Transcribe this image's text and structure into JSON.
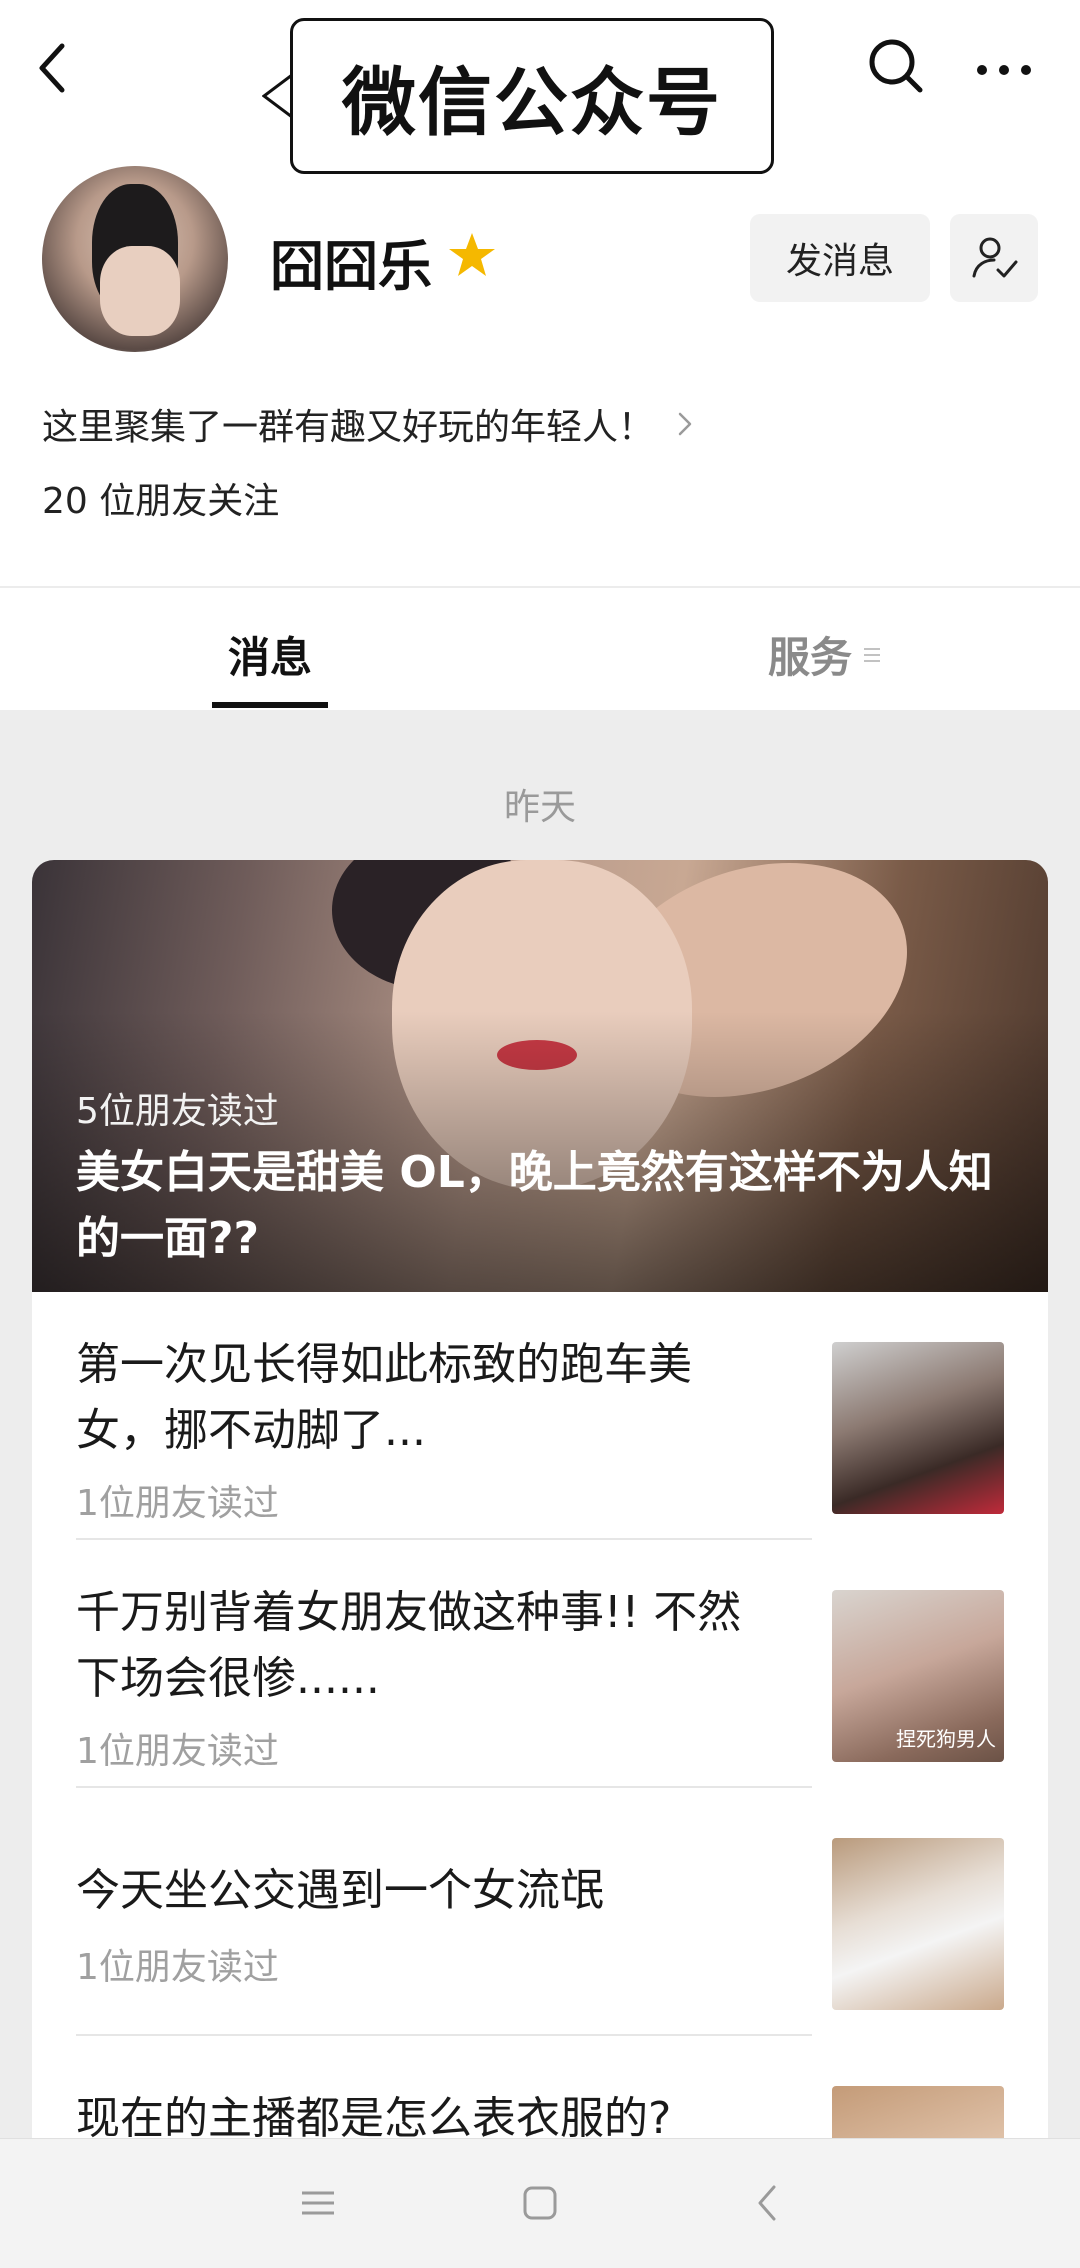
{
  "header": {
    "callout_label": "微信公众号"
  },
  "profile": {
    "name": "囧囧乐",
    "message_button": "发消息",
    "intro": "这里聚集了一群有趣又好玩的年轻人！",
    "followers": "20 位朋友关注"
  },
  "tabs": [
    {
      "label": "消息",
      "active": true
    },
    {
      "label": "服务",
      "active": false
    }
  ],
  "feed": {
    "date": "昨天",
    "cover": {
      "readers": "5位朋友读过",
      "title": "美女白天是甜美 OL，晚上竟然有这样不为人知的一面??"
    },
    "articles": [
      {
        "title": "第一次见长得如此标致的跑车美女，挪不动脚了...",
        "reads": "1位朋友读过",
        "thumb_watermark": ""
      },
      {
        "title": "千万别背着女朋友做这种事!! 不然下场会很惨......",
        "reads": "1位朋友读过",
        "thumb_watermark": "捏死狗男人"
      },
      {
        "title": "今天坐公交遇到一个女流氓",
        "reads": "1位朋友读过",
        "thumb_watermark": ""
      },
      {
        "title": "现在的主播都是怎么表衣服的?",
        "reads": "",
        "thumb_watermark": ""
      }
    ]
  },
  "colors": {
    "star": "#f5b800",
    "feed_background": "#ededed",
    "active_tab": "#111111",
    "inactive_tab": "#8a8a8a"
  },
  "icons": [
    "back-arrow-icon",
    "search-icon",
    "more-icon",
    "star-icon",
    "follow-check-icon",
    "chevron-right-icon",
    "menu-lines-icon",
    "home-square-icon",
    "back-triangle-icon"
  ]
}
